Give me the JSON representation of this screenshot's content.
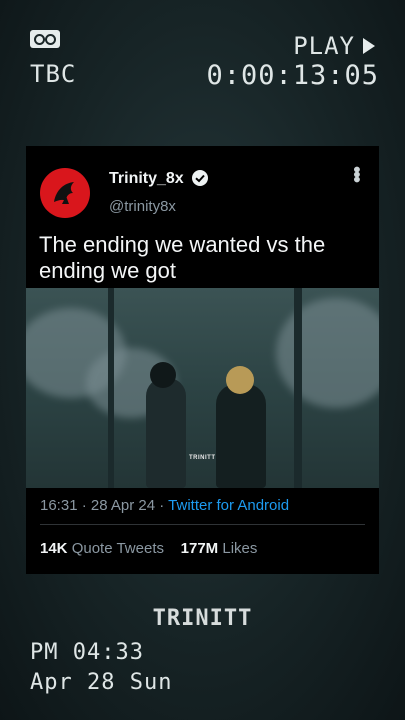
{
  "vhs": {
    "tbc": "TBC",
    "play": "PLAY",
    "counter": "0:00:13:05",
    "time": "PM 04:33",
    "date": "Apr 28 Sun"
  },
  "tweet": {
    "display_name": "Trinity_8x",
    "handle": "@trinity8x",
    "text": "The ending we wanted vs the ending we got",
    "media_watermark": "TRINITT",
    "time": "16:31",
    "date": "28 Apr 24",
    "source": "Twitter for Android",
    "quote_count": "14K",
    "quote_label": "Quote Tweets",
    "like_count": "177M",
    "like_label": "Likes"
  },
  "watermark": "TRINITT",
  "icons": [
    "vhs-tape-icon",
    "play-triangle-icon",
    "verified-badge-icon",
    "more-options-icon"
  ],
  "colors": {
    "avatar_bg": "#d9161c",
    "link": "#1d9bf0",
    "card_bg": "#000000"
  }
}
